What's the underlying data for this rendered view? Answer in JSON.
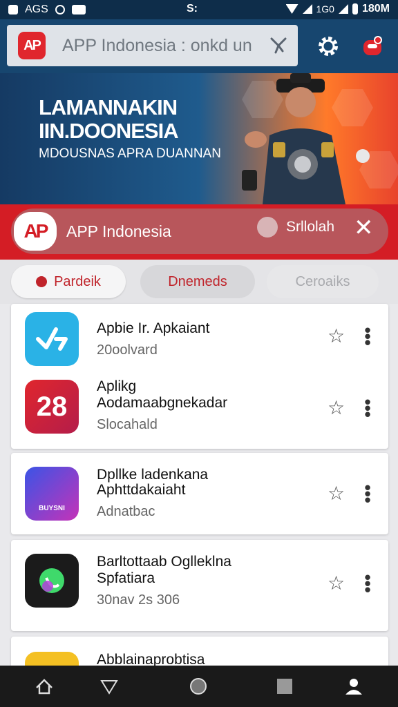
{
  "status_bar": {
    "left_text": "AGS",
    "center_text": "S:",
    "right_text": "180M",
    "signal_text": "1G0"
  },
  "search": {
    "logo_text": "AP",
    "value": "APP Indonesia : onkd un"
  },
  "banner": {
    "title_line1": "LAMANNAKIN",
    "title_line2": "IIN.DOONESIA",
    "subtitle": "MDOUSNAS APRA DUANNAN"
  },
  "app_strip": {
    "logo_text": "AP",
    "name": "APP Indonesia",
    "cta_label": "Srllolah"
  },
  "chips": [
    {
      "label": "Pardeik"
    },
    {
      "label": "Dnemeds"
    },
    {
      "label": "Ceroaiks"
    }
  ],
  "list": [
    {
      "title": "Apbie Ir. Apkaiant",
      "subtitle": "20oolvard",
      "icon_text": "",
      "icon_color": "#2ab2e6"
    },
    {
      "title": "Aplikg",
      "title2": "Aodamaabgnekadar",
      "subtitle": "Slocahald",
      "icon_text": "28",
      "icon_color": "#d82a3a"
    },
    {
      "title": "Dpllke ladenkana",
      "title2": "Aphttdakaiaht",
      "subtitle": "Adnatbac",
      "icon_text": "BUYSNI",
      "icon_color": "#5a3ad6"
    },
    {
      "title": "Barltottaab Oglleklna",
      "title2": "Spfatiara",
      "subtitle": "30nav 2s 306",
      "icon_text": "",
      "icon_color": "#1b1b1b"
    },
    {
      "title": "Abblainaprobtisa",
      "subtitle": "",
      "icon_text": "",
      "icon_color": "#f4c023"
    }
  ],
  "colors": {
    "brand_red": "#d41d25",
    "top_bar": "#17466f",
    "nav_bar": "#1a1a1a"
  }
}
